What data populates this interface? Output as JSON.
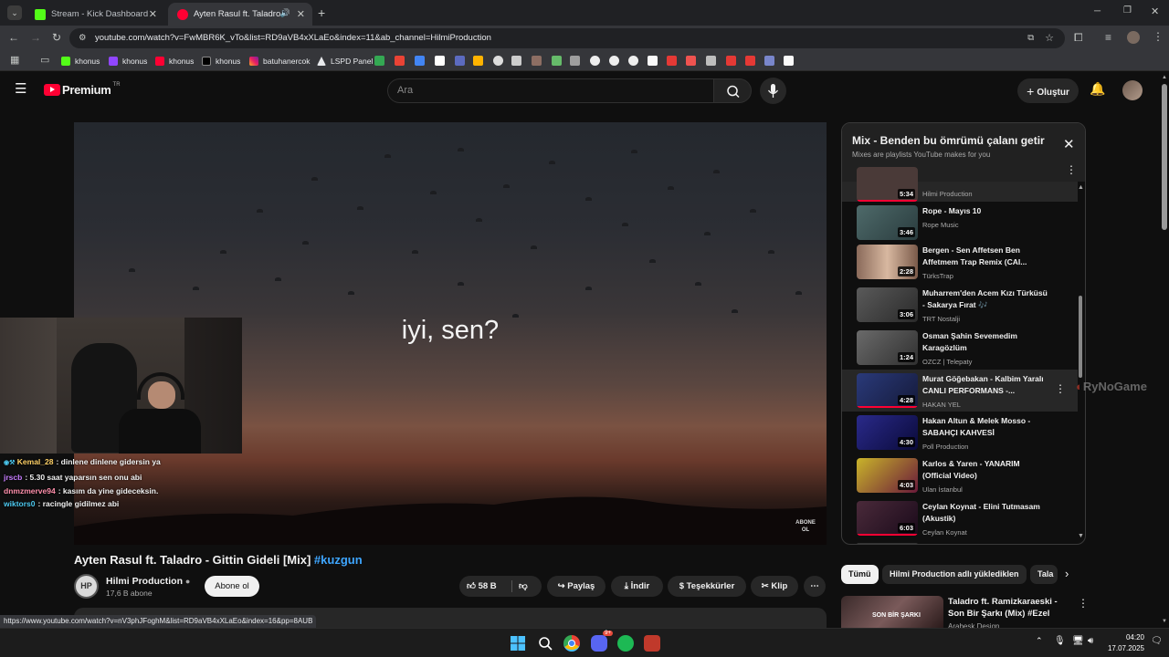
{
  "browser": {
    "tabs": [
      {
        "title": "Stream - Kick Dashboard",
        "active": false
      },
      {
        "title": "Ayten Rasul ft. Taladro - Git",
        "active": true
      }
    ],
    "url": "youtube.com/watch?v=FwMBR6K_vTo&list=RD9aVB4xXLaEo&index=11&ab_channel=HilmiProduction",
    "bookmarks": [
      "khonus",
      "khonus",
      "khonus",
      "khonus",
      "batuhanercok",
      "LSPD Panel"
    ],
    "status_url": "https://www.youtube.com/watch?v=nV3phJFoghM&list=RD9aVB4xXLaEo&index=16&pp=8AUB"
  },
  "youtube": {
    "logo": "Premium",
    "logo_sup": "TR",
    "search_placeholder": "Ara",
    "create_label": "Oluştur",
    "video": {
      "subtitle": "iyi, sen?",
      "watermark": "ABONE OL",
      "title": "Ayten Rasul ft. Taladro - Gittin Gideli [Mix]",
      "hashtag": "#kuzgun",
      "channel": "Hilmi Production",
      "subscribers": "17,6 B abone",
      "subscribe_label": "Abone ol",
      "likes": "58 B",
      "share_label": "Paylaş",
      "download_label": "İndir",
      "thanks_label": "Teşekkürler",
      "clip_label": "Klip"
    },
    "mix": {
      "title": "Mix - Benden bu ömrümü çalanı getir",
      "subtitle": "Mixes are playlists YouTube makes for you",
      "items": [
        {
          "title": "",
          "channel": "Hilmi Production",
          "duration": "5:34"
        },
        {
          "title": "Rope - Mayıs 10",
          "channel": "Rope Music",
          "duration": "3:46"
        },
        {
          "title": "Bergen - Sen Affetsen Ben Affetmem Trap Remix (CAI...",
          "channel": "TürksTrap",
          "duration": "2:28"
        },
        {
          "title": "Muharrem'den Acem Kızı Türküsü - Sakarya Fırat 🎶",
          "channel": "TRT Nostalji",
          "duration": "3:06"
        },
        {
          "title": "Osman Şahin Sevemedim Karagözlüm",
          "channel": "OZCZ | Telepaty",
          "duration": "1:24"
        },
        {
          "title": "Murat Göğebakan - Kalbim Yaralı CANLI PERFORMANS -...",
          "channel": "HAKAN YEL",
          "duration": "4:28"
        },
        {
          "title": "Hakan Altun & Melek Mosso - SABAHÇI KAHVESİ",
          "channel": "Poll Production",
          "duration": "4:30"
        },
        {
          "title": "Karlos & Yaren - YANARIM (Official Video)",
          "channel": "Ulan İstanbul",
          "duration": "4:03"
        },
        {
          "title": "Ceylan Koynat - Elini Tutmasam (Akustik)",
          "channel": "Ceylan Koynat",
          "duration": "6:03"
        }
      ]
    },
    "chips": [
      "Tümü",
      "Hilmi Production adlı yüklediklen",
      "Tala"
    ],
    "recommended": {
      "title": "Taladro ft. Ramizkaraeski - Son Bir Şarkı (Mix) #Ezel",
      "channel": "Arabesk Design",
      "thumb_text": "SON BİR ŞARKI"
    }
  },
  "stream_chat": [
    {
      "user": "Kemal_28",
      "color": "#ffd166",
      "text": ": dinlene dinlene gidersin ya"
    },
    {
      "user": "jrscb",
      "color": "#c77dff",
      "text": ": 5.30 saat yaparsın sen onu abi"
    },
    {
      "user": "dnmzmerve94",
      "color": "#ff8fab",
      "text": ": kasım da yine gideceksin."
    },
    {
      "user": "wiktors0",
      "color": "#4cc9f0",
      "text": ": racingle gidilmez abi"
    }
  ],
  "overlay_watermark": "RyNoGame",
  "taskbar": {
    "time": "04:20",
    "date": "17.07.2025",
    "discord_badge": "9+"
  }
}
